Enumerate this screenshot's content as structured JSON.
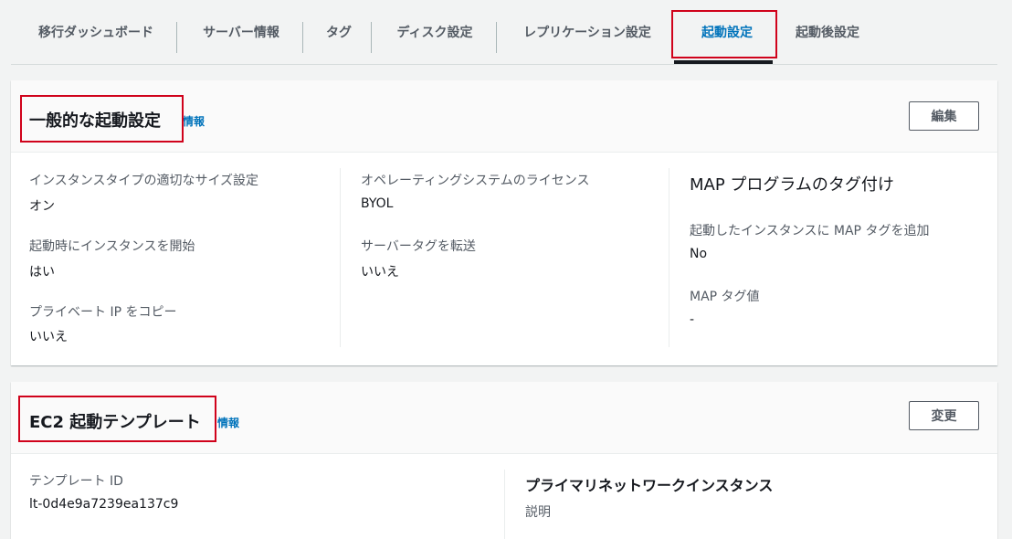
{
  "tabs": [
    {
      "label": "移行ダッシュボード"
    },
    {
      "label": "サーバー情報"
    },
    {
      "label": "タグ"
    },
    {
      "label": "ディスク設定"
    },
    {
      "label": "レプリケーション設定"
    },
    {
      "label": "起動設定"
    },
    {
      "label": "起動後設定"
    }
  ],
  "active_tab": "起動設定",
  "general": {
    "title": "一般的な起動設定",
    "info": "情報",
    "edit_button": "編集",
    "col1": [
      {
        "label": "インスタンスタイプの適切なサイズ設定",
        "value": "オン"
      },
      {
        "label": "起動時にインスタンスを開始",
        "value": "はい"
      },
      {
        "label": "プライベート IP をコピー",
        "value": "いいえ"
      }
    ],
    "col2": [
      {
        "label": "オペレーティングシステムのライセンス",
        "value": "BYOL"
      },
      {
        "label": "サーバータグを転送",
        "value": "いいえ"
      }
    ],
    "col3": {
      "heading": "MAP プログラムのタグ付け",
      "items": [
        {
          "label": "起動したインスタンスに MAP タグを追加",
          "value": "No"
        },
        {
          "label": "MAP タグ値",
          "value": "-"
        }
      ]
    }
  },
  "ec2": {
    "title": "EC2 起動テンプレート",
    "info": "情報",
    "change_button": "変更",
    "template_id_label": "テンプレート ID",
    "template_id_value": "lt-0d4e9a7239ea137c9",
    "primary_heading": "プライマリネットワークインスタンス",
    "description_label": "説明"
  },
  "colors": {
    "highlight": "#d0021b",
    "link": "#0073bb",
    "active_tab": "#0073bb"
  }
}
